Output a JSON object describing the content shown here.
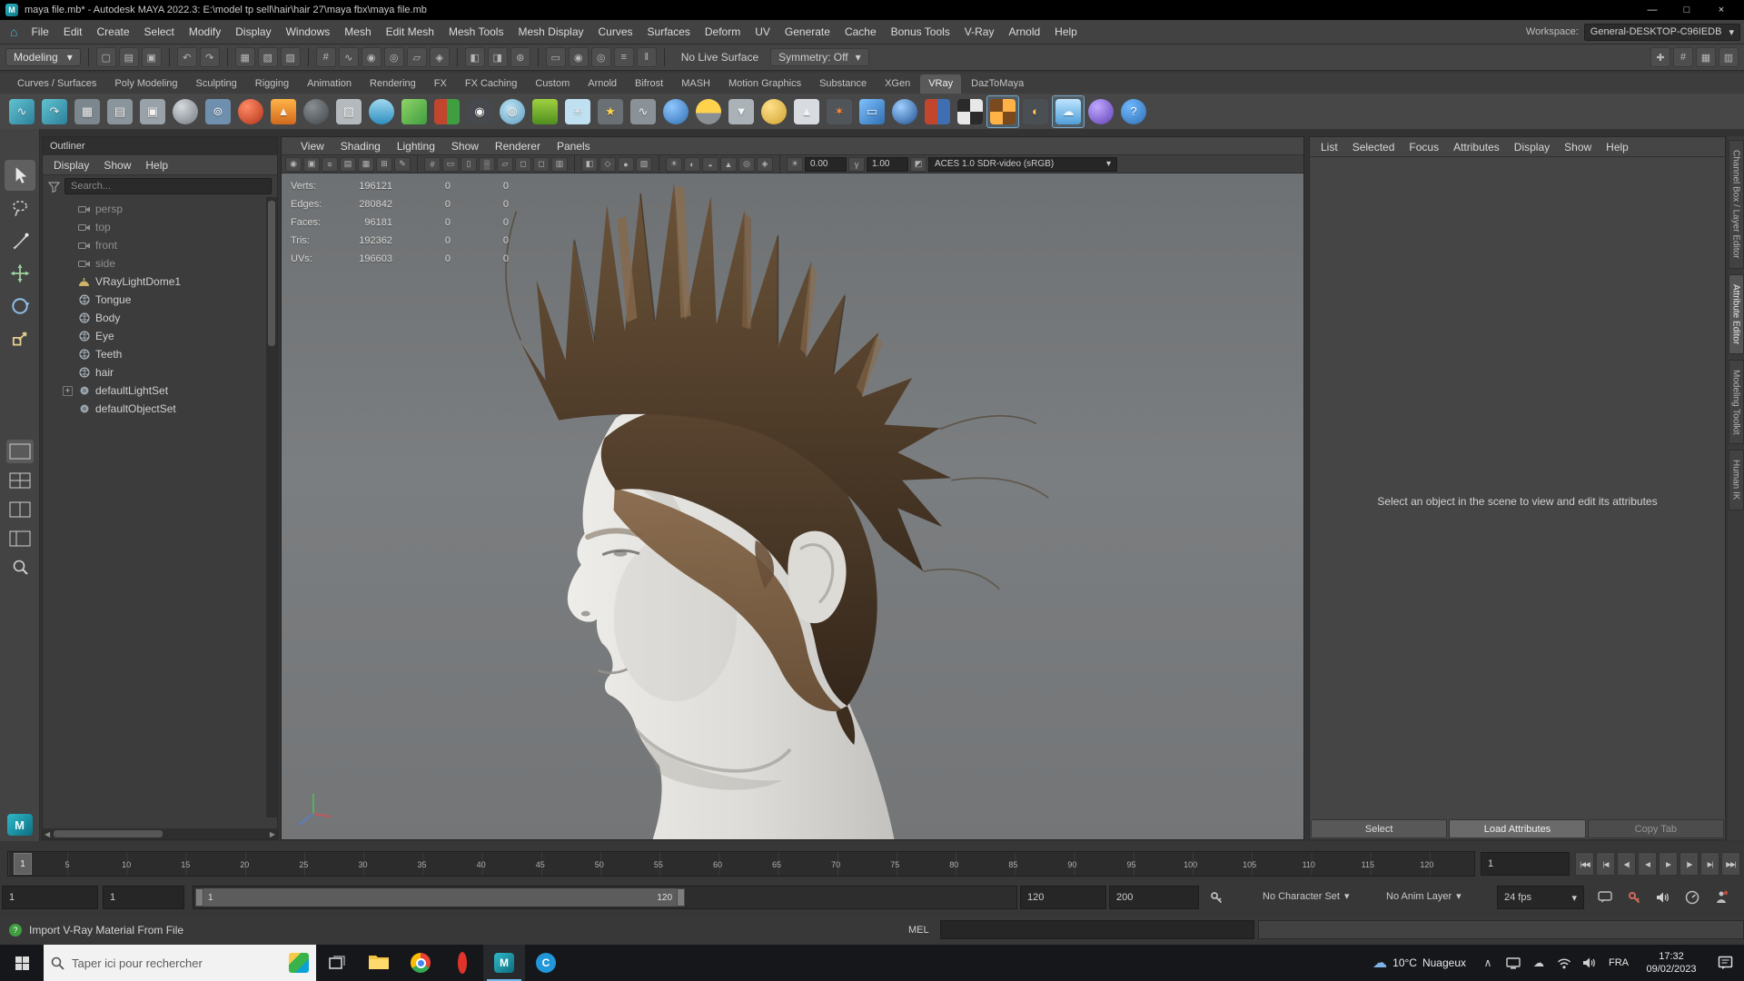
{
  "window": {
    "title": "maya file.mb* - Autodesk MAYA 2022.3: E:\\model tp sell\\hair\\hair 27\\maya fbx\\maya file.mb",
    "minimize": "—",
    "maximize": "□",
    "close": "×"
  },
  "menu_bar": {
    "items": [
      "File",
      "Edit",
      "Create",
      "Select",
      "Modify",
      "Display",
      "Windows",
      "Mesh",
      "Edit Mesh",
      "Mesh Tools",
      "Mesh Display",
      "Curves",
      "Surfaces",
      "Deform",
      "UV",
      "Generate",
      "Cache",
      "Bonus Tools",
      "V-Ray",
      "Arnold",
      "Help"
    ],
    "workspace_label": "Workspace:",
    "workspace_value": "General-DESKTOP-C96IEDB"
  },
  "status_line": {
    "mode": "Modeling",
    "live_surface": "No Live Surface",
    "symmetry": "Symmetry: Off",
    "icon_groups": [
      {
        "icons": [
          {
            "n": "new-scene-icon",
            "g": "▢"
          },
          {
            "n": "open-scene-icon",
            "g": "▤"
          },
          {
            "n": "save-scene-icon",
            "g": "▣"
          }
        ]
      },
      {
        "icons": [
          {
            "n": "undo-icon",
            "g": "↶"
          },
          {
            "n": "redo-icon",
            "g": "↷"
          }
        ]
      },
      {
        "icons": [
          {
            "n": "select-hierarchy-icon",
            "g": "▦"
          },
          {
            "n": "select-object-icon",
            "g": "▧"
          },
          {
            "n": "select-component-icon",
            "g": "▨"
          }
        ]
      },
      {
        "icons": [
          {
            "n": "snap-grid-icon",
            "g": "#"
          },
          {
            "n": "snap-curve-icon",
            "g": "∿"
          },
          {
            "n": "snap-point-icon",
            "g": "◉"
          },
          {
            "n": "snap-projected-center-icon",
            "g": "◎"
          },
          {
            "n": "snap-view-plane-icon",
            "g": "▱"
          },
          {
            "n": "make-live-icon",
            "g": "◈"
          }
        ]
      },
      {
        "icons": [
          {
            "n": "input-connections-icon",
            "g": "◧"
          },
          {
            "n": "output-connections-icon",
            "g": "◨"
          },
          {
            "n": "construction-history-icon",
            "g": "⊛"
          }
        ]
      },
      {
        "icons": [
          {
            "n": "open-render-view-icon",
            "g": "▭"
          },
          {
            "n": "render-current-frame-icon",
            "g": "◉"
          },
          {
            "n": "ipr-render-icon",
            "g": "◎"
          },
          {
            "n": "render-settings-icon",
            "g": "≡"
          },
          {
            "n": "pause-viewport-icon",
            "g": "‖"
          }
        ]
      }
    ],
    "right_icons": [
      {
        "n": "show-manipulator-icon",
        "g": "✚"
      },
      {
        "n": "grid-toggle-icon",
        "g": "#"
      },
      {
        "n": "panel-layout-icon",
        "g": "▦"
      },
      {
        "n": "outliner-toggle-icon",
        "g": "▥"
      }
    ]
  },
  "shelf": {
    "active_tab": "VRay",
    "tabs": [
      "Curves / Surfaces",
      "Poly Modeling",
      "Sculpting",
      "Rigging",
      "Animation",
      "Rendering",
      "FX",
      "FX Caching",
      "Custom",
      "Arnold",
      "Bifrost",
      "MASH",
      "Motion Graphics",
      "Substance",
      "XGen",
      "VRay",
      "DazToMaya"
    ],
    "icons": [
      {
        "bg": "linear-gradient(135deg,#5fc3d0,#2e7f9b)",
        "g": "∿"
      },
      {
        "bg": "linear-gradient(135deg,#5fc3d0,#2e7f9b)",
        "g": "↷"
      },
      {
        "bg": "#7c868d",
        "g": "▦"
      },
      {
        "bg": "#8a949b",
        "g": "▤"
      },
      {
        "bg": "#99a2a8",
        "g": "▣"
      },
      {
        "bg": "radial-gradient(circle at 35% 30%,#d6dade,#70787f)",
        "round": true
      },
      {
        "bg": "#6f8fae",
        "g": "⊚"
      },
      {
        "bg": "radial-gradient(circle at 35% 30%,#ff8a66,#b03418)",
        "round": true
      },
      {
        "bg": "linear-gradient(180deg,#ffb347,#d2691e)",
        "g": "▲"
      },
      {
        "bg": "radial-gradient(circle at 35% 30%,#8a8f94,#3f4448)",
        "round": true
      },
      {
        "bg": "#b4b9bd",
        "g": "▨"
      },
      {
        "bg": "linear-gradient(180deg,#9fd8f0,#2f8fc0)",
        "round": true
      },
      {
        "bg": "linear-gradient(135deg,#8fd468,#3f9e3f)"
      },
      {
        "bg": "linear-gradient(90deg,#c2452e 50%,#3f9e3f 50%)"
      },
      {
        "bg": "#45494d",
        "g": "◉"
      },
      {
        "bg": "radial-gradient(circle at 40% 35%,#bfe4f4,#5a9cc0)",
        "g": "◍",
        "round": true
      },
      {
        "bg": "linear-gradient(180deg,#9fd040,#4f8f20)"
      },
      {
        "bg": "#bfe0f0",
        "g": "✳"
      },
      {
        "bg": "#6b7074",
        "g": "★",
        "fg": "#ffd24d"
      },
      {
        "bg": "#8a9298",
        "g": "∿"
      },
      {
        "bg": "radial-gradient(circle at 35% 30%,#8fc6ff,#2f6fb2)",
        "round": true
      },
      {
        "bg": "linear-gradient(180deg,#ffd24d 55%,#8a8f94 55%)",
        "round": true
      },
      {
        "bg": "#aab2b8",
        "g": "▼"
      },
      {
        "bg": "radial-gradient(circle at 35% 30%,#ffe08a,#cfa12e)",
        "round": true
      },
      {
        "bg": "#d8dce0",
        "g": "▲"
      },
      {
        "bg": "#50555a",
        "g": "✶",
        "fg": "#ff8a3d"
      },
      {
        "bg": "linear-gradient(135deg,#7fc0ff,#2f6fb2)",
        "g": "▭"
      },
      {
        "bg": "radial-gradient(circle at 35% 30%,#9fd0ff,#1f4f8f)",
        "round": true
      },
      {
        "bg": "linear-gradient(90deg,#c2452e 50%,#3f6fb2 50%)"
      },
      {
        "bg": "conic-gradient(#e8e8e8 0 25%,#2a2a2a 0 50%,#e8e8e8 0 75%,#2a2a2a 0)"
      },
      {
        "bg": "conic-gradient(#ffb347 0 25%,#7a4a1e 0 50%,#ffb347 0 75%,#7a4a1e 0)",
        "selected": true
      },
      {
        "bg": "#4a4f54",
        "g": "◐",
        "fg": "#ffd24d"
      },
      {
        "bg": "linear-gradient(180deg,#bfe4ff,#4f9fd9)",
        "g": "☁",
        "fg": "#eef7ff",
        "selected": true
      },
      {
        "bg": "radial-gradient(circle at 35% 30%,#c0a8ff,#5f3fb2)",
        "round": true
      },
      {
        "bg": "radial-gradient(circle at 35% 30%,#6fb8ff,#2f6fb2)",
        "g": "?",
        "fg": "#ffffff",
        "round": true
      }
    ]
  },
  "toolbox": {
    "tools": [
      {
        "n": "select-tool",
        "active": true
      },
      {
        "n": "lasso-tool"
      },
      {
        "n": "paint-select-tool"
      },
      {
        "n": "move-tool"
      },
      {
        "n": "rotate-tool"
      },
      {
        "n": "scale-tool"
      }
    ],
    "layouts": [
      {
        "n": "layout-single-pane",
        "active": true
      },
      {
        "n": "layout-four-pane"
      },
      {
        "n": "layout-two-pane"
      },
      {
        "n": "layout-pane-outliner"
      }
    ]
  },
  "outliner": {
    "title": "Outliner",
    "menus": [
      "Display",
      "Show",
      "Help"
    ],
    "search_placeholder": "Search...",
    "items": [
      {
        "label": "persp",
        "type": "camera",
        "muted": true
      },
      {
        "label": "top",
        "type": "camera",
        "muted": true
      },
      {
        "label": "front",
        "type": "camera",
        "muted": true
      },
      {
        "label": "side",
        "type": "camera",
        "muted": true
      },
      {
        "label": "VRayLightDome1",
        "type": "light"
      },
      {
        "label": "Tongue",
        "type": "mesh"
      },
      {
        "label": "Body",
        "type": "mesh"
      },
      {
        "label": "Eye",
        "type": "mesh"
      },
      {
        "label": "Teeth",
        "type": "mesh"
      },
      {
        "label": "hair",
        "type": "mesh"
      },
      {
        "label": "defaultLightSet",
        "type": "set",
        "expandable": true
      },
      {
        "label": "defaultObjectSet",
        "type": "set"
      }
    ]
  },
  "viewport": {
    "menus": [
      "View",
      "Shading",
      "Lighting",
      "Show",
      "Renderer",
      "Panels"
    ],
    "toolbar": {
      "icons": [
        {
          "n": "select-camera-icon",
          "g": "◉"
        },
        {
          "n": "lock-camera-icon",
          "g": "▣"
        },
        {
          "n": "camera-attributes-icon",
          "g": "≡"
        },
        {
          "n": "bookmarks-icon",
          "g": "▤"
        },
        {
          "n": "image-plane-icon",
          "g": "▦"
        },
        {
          "n": "two-d-pan-zoom-icon",
          "g": "⊞"
        },
        {
          "n": "grease-pencil-icon",
          "g": "✎"
        },
        {
          "n": "grid-icon",
          "g": "#"
        },
        {
          "n": "film-gate-icon",
          "g": "▭"
        },
        {
          "n": "resolution-gate-icon",
          "g": "▯"
        },
        {
          "n": "gate-mask-icon",
          "g": "▒"
        },
        {
          "n": "field-chart-icon",
          "g": "▱"
        },
        {
          "n": "safe-action-icon",
          "g": "◻"
        },
        {
          "n": "safe-title-icon",
          "g": "◻"
        },
        {
          "n": "hud-toggle-icon",
          "g": "▥"
        },
        {
          "n": "xray-icon",
          "g": "◧"
        },
        {
          "n": "wireframe-icon",
          "g": "◇"
        },
        {
          "n": "shaded-icon",
          "g": "●"
        },
        {
          "n": "textured-icon",
          "g": "▨"
        },
        {
          "n": "use-all-lights-icon",
          "g": "☀"
        },
        {
          "n": "shadows-icon",
          "g": "◐"
        },
        {
          "n": "ambient-occlusion-icon",
          "g": "◒"
        },
        {
          "n": "anti-alias-icon",
          "g": "▲"
        },
        {
          "n": "depth-of-field-icon",
          "g": "◎"
        },
        {
          "n": "isolate-select-icon",
          "g": "◈"
        }
      ],
      "exposure_value": "0.00",
      "gamma_value": "1.00",
      "colorspace_value": "ACES 1.0 SDR-video (sRGB)"
    },
    "hud": {
      "rows": [
        {
          "label": "Verts:",
          "v1": "196121",
          "v2": "0",
          "v3": "0"
        },
        {
          "label": "Edges:",
          "v1": "280842",
          "v2": "0",
          "v3": "0"
        },
        {
          "label": "Faces:",
          "v1": "96181",
          "v2": "0",
          "v3": "0"
        },
        {
          "label": "Tris:",
          "v1": "192362",
          "v2": "0",
          "v3": "0"
        },
        {
          "label": "UVs:",
          "v1": "196603",
          "v2": "0",
          "v3": "0"
        }
      ]
    }
  },
  "attribute_editor": {
    "menus": [
      "List",
      "Selected",
      "Focus",
      "Attributes",
      "Display",
      "Show",
      "Help"
    ],
    "empty_message": "Select an object in the scene to view and edit its attributes",
    "buttons": [
      {
        "label": "Select"
      },
      {
        "label": "Load Attributes",
        "highlight": true
      },
      {
        "label": "Copy Tab",
        "disabled": true
      }
    ]
  },
  "side_tabs": [
    {
      "label": "Channel Box / Layer Editor"
    },
    {
      "label": "Attribute Editor",
      "active": true
    },
    {
      "label": "Modeling Toolkit"
    },
    {
      "label": "Human IK"
    }
  ],
  "timeline": {
    "ticks": [
      5,
      10,
      15,
      20,
      25,
      30,
      35,
      40,
      45,
      50,
      55,
      60,
      65,
      70,
      75,
      80,
      85,
      90,
      95,
      100,
      105,
      110,
      115,
      120
    ],
    "current_frame": "1",
    "current_frame_field": "1",
    "playback_buttons": [
      {
        "n": "go-to-start-button",
        "g": "|◀◀"
      },
      {
        "n": "step-back-frame-button",
        "g": "|◀"
      },
      {
        "n": "step-back-key-button",
        "g": "◀|"
      },
      {
        "n": "play-backwards-button",
        "g": "◀"
      },
      {
        "n": "play-forwards-button",
        "g": "▶"
      },
      {
        "n": "step-forward-key-button",
        "g": "|▶"
      },
      {
        "n": "step-forward-frame-button",
        "g": "▶|"
      },
      {
        "n": "go-to-end-button",
        "g": "▶▶|"
      }
    ]
  },
  "range_slider": {
    "anim_start": "1",
    "playback_start": "1",
    "bar_start": "1",
    "bar_end": "120",
    "playback_end": "120",
    "anim_end": "200",
    "character_set": "No Character Set",
    "anim_layer": "No Anim Layer",
    "fps": "24 fps"
  },
  "command_line": {
    "mel_label": "MEL",
    "input_value": ""
  },
  "help_line": {
    "text": "Import V-Ray Material From File"
  },
  "taskbar": {
    "search_placeholder": "Taper ici pour rechercher",
    "apps": [
      {
        "n": "file-explorer-icon"
      },
      {
        "n": "chrome-icon"
      },
      {
        "n": "opera-icon"
      },
      {
        "n": "maya-icon",
        "active": true
      },
      {
        "n": "c-app-icon"
      }
    ],
    "tray": [
      {
        "n": "hidden-icons-chevron"
      },
      {
        "n": "display-tray-icon"
      },
      {
        "n": "cloud-tray-icon"
      },
      {
        "n": "network-tray-icon"
      },
      {
        "n": "volume-tray-icon"
      }
    ],
    "weather_temp": "10°C",
    "weather_desc": "Nuageux",
    "language": "FRA",
    "time": "17:32",
    "date": "09/02/2023"
  }
}
